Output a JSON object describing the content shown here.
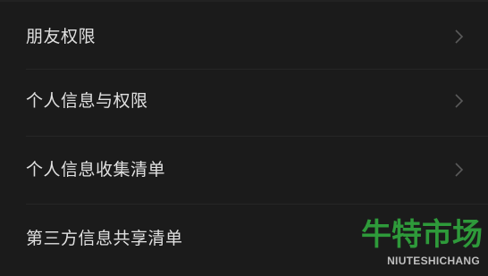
{
  "menu": {
    "items": [
      {
        "label": "朋友权限",
        "icon": "chevron-right-icon"
      },
      {
        "label": "个人信息与权限",
        "icon": "chevron-right-icon"
      },
      {
        "label": "个人信息收集清单",
        "icon": "chevron-right-icon"
      },
      {
        "label": "第三方信息共享清单",
        "icon": "chevron-right-icon"
      }
    ]
  },
  "watermark": {
    "title": "牛特市场",
    "subtitle": "NIUTESHICHANG"
  },
  "colors": {
    "background": "#1b1b1b",
    "text": "#e0e0e0",
    "chevron": "#5a5a5a",
    "watermark_green": "#2e9a3a"
  }
}
